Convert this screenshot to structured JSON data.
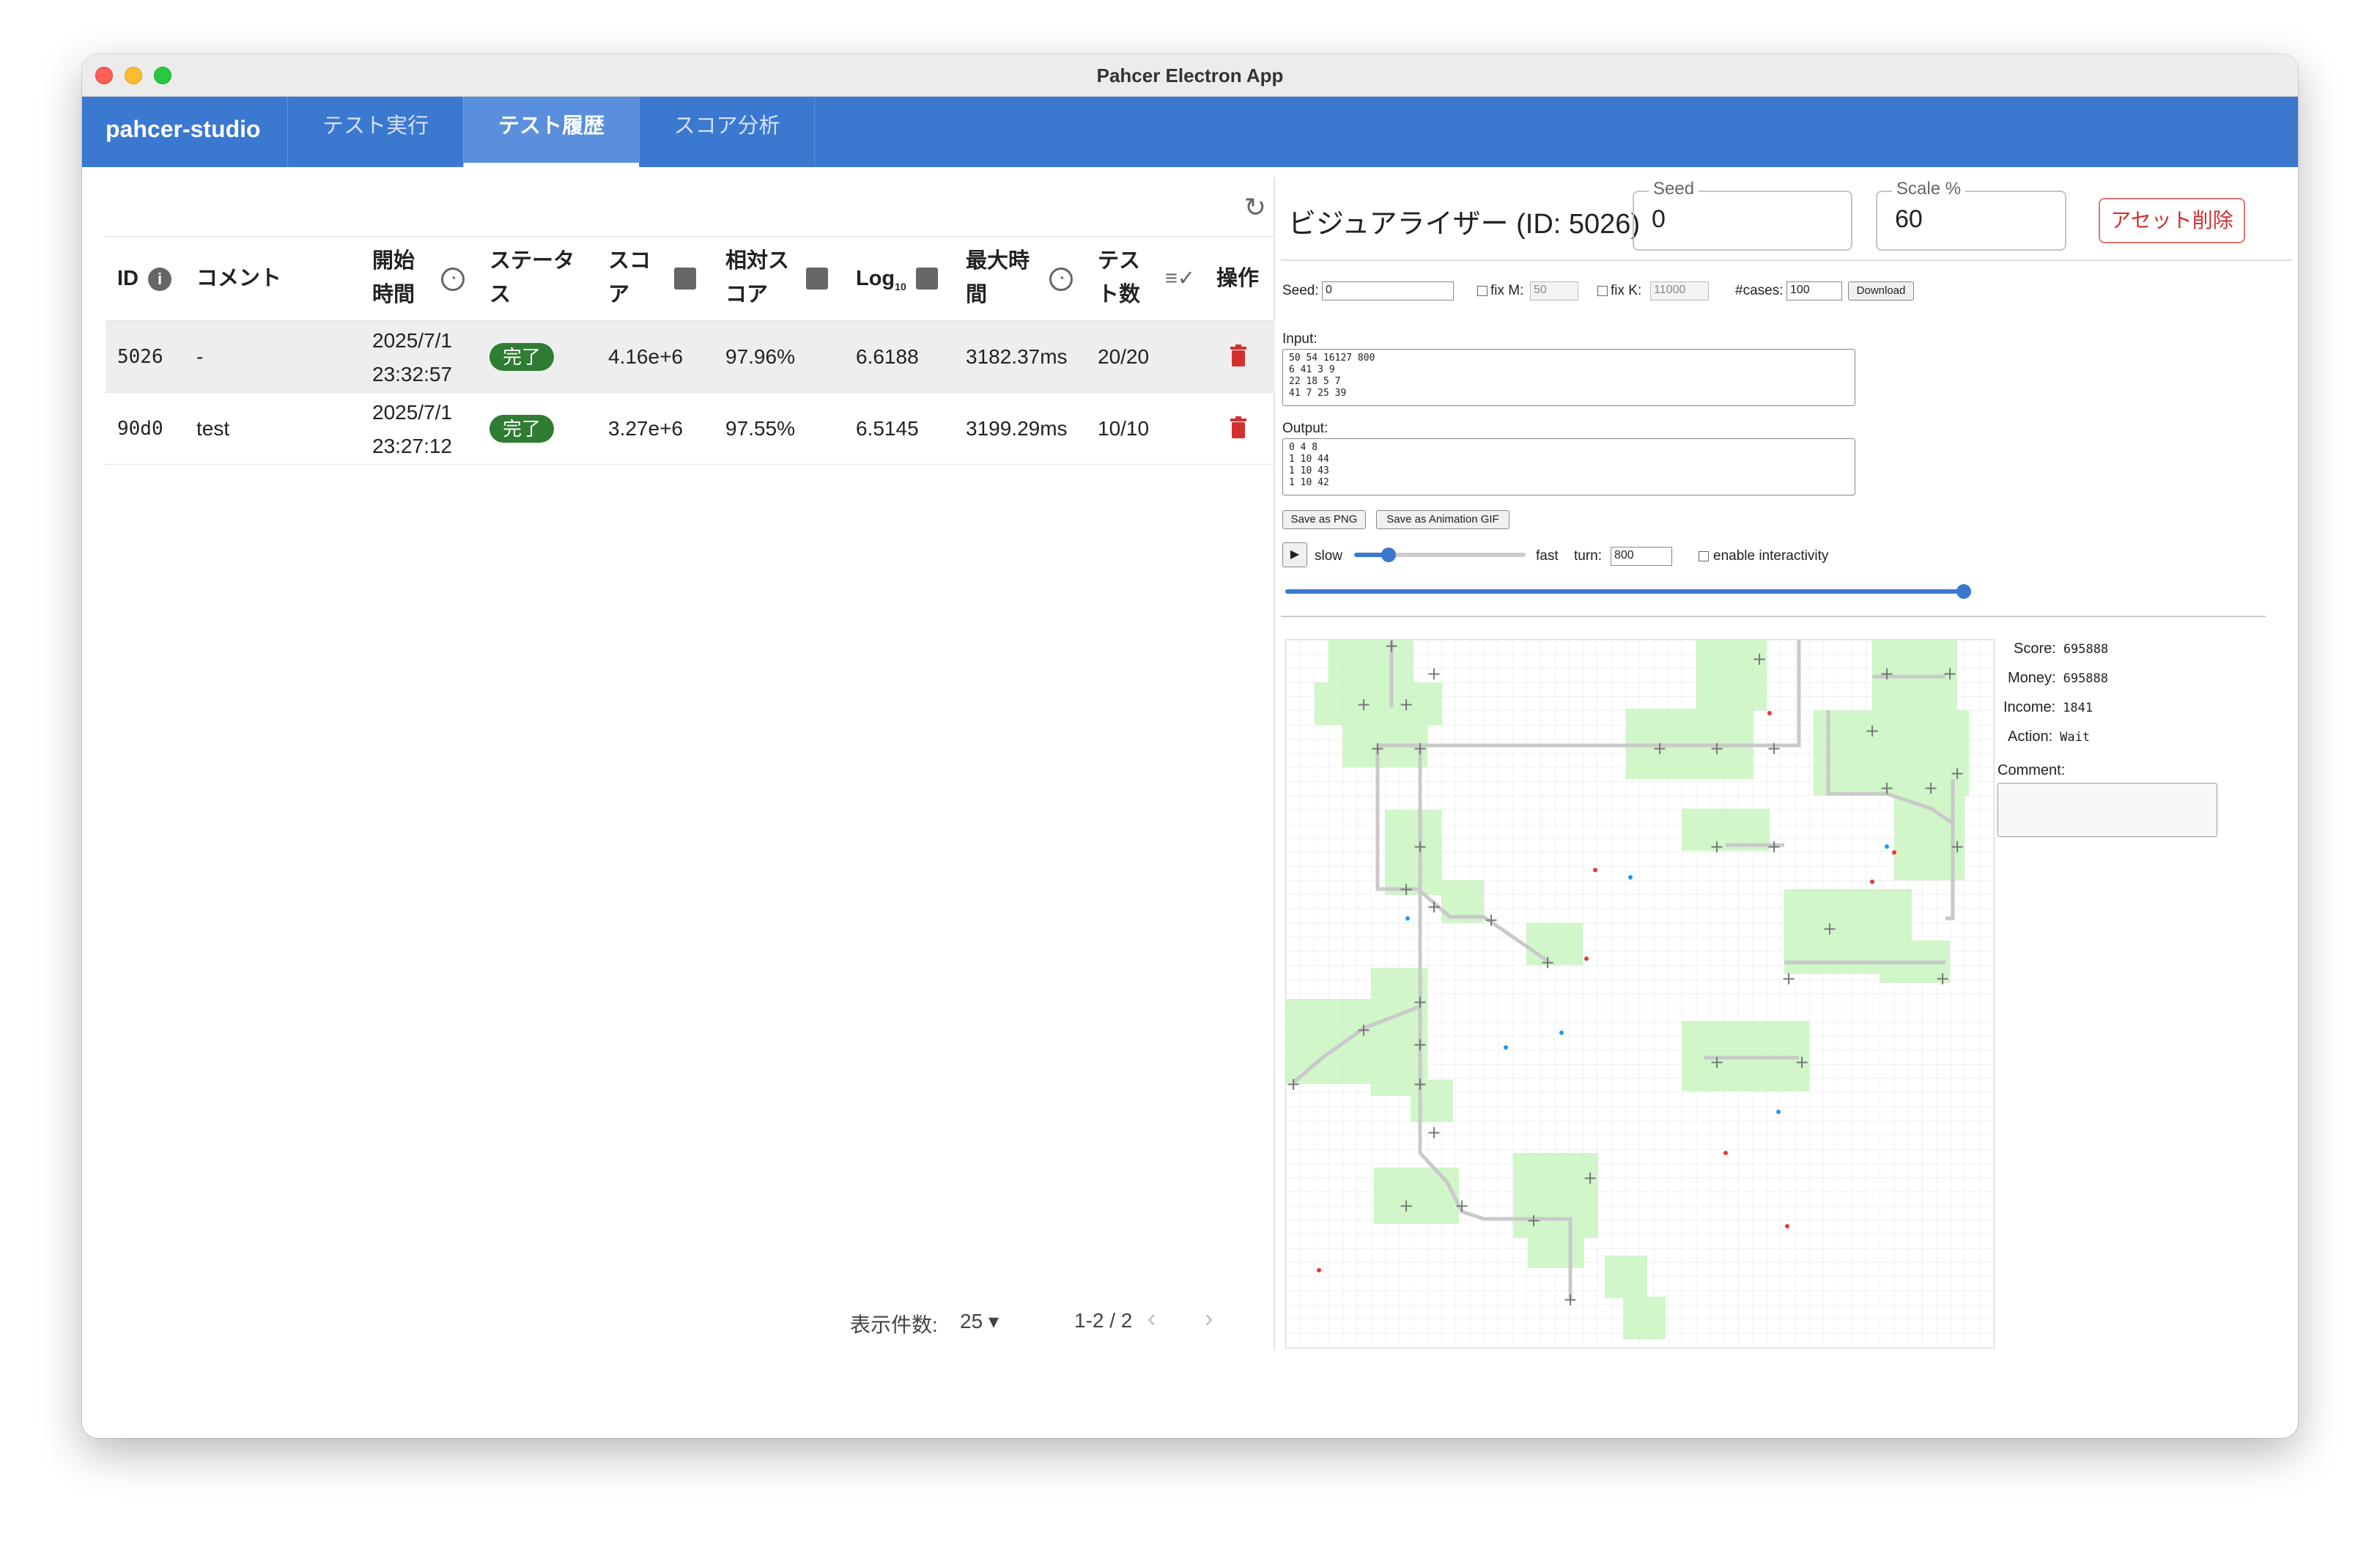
{
  "window": {
    "title": "Pahcer Electron App"
  },
  "app": {
    "brand": "pahcer-studio",
    "tabs": [
      {
        "label": "テスト実行"
      },
      {
        "label": "テスト履歴"
      },
      {
        "label": "スコア分析"
      }
    ],
    "active_tab": "テスト履歴"
  },
  "table": {
    "columns": {
      "id": "ID",
      "comment": "コメント",
      "start_time_1": "開始",
      "start_time_2": "時間",
      "status_1": "ステータ",
      "status_2": "ス",
      "score_1": "スコ",
      "score_2": "ア",
      "relscore_1": "相対ス",
      "relscore_2": "コア",
      "log": "Log",
      "log_sub": "10",
      "maxtime_1": "最大時",
      "maxtime_2": "間",
      "tests_1": "テス",
      "tests_2": "ト数",
      "actions": "操作"
    },
    "rows": [
      {
        "id": "5026",
        "comment": "-",
        "date": "2025/7/1",
        "time": "23:32:57",
        "status": "完了",
        "score": "4.16e+6",
        "relscore": "97.96%",
        "log": "6.6188",
        "maxtime": "3182.37ms",
        "tests": "20/20"
      },
      {
        "id": "90d0",
        "comment": "test",
        "date": "2025/7/1",
        "time": "23:27:12",
        "status": "完了",
        "score": "3.27e+6",
        "relscore": "97.55%",
        "log": "6.5145",
        "maxtime": "3199.29ms",
        "tests": "10/10"
      }
    ]
  },
  "pagination": {
    "rows_label": "表示件数:",
    "rows_value": "25",
    "range": "1-2 / 2"
  },
  "visualizer": {
    "title": "ビジュアライザー (ID: 5026)",
    "seed_label": "Seed",
    "seed_value": "0",
    "scale_label": "Scale %",
    "scale_value": "60",
    "delete_label": "アセット削除",
    "seed_small_label": "Seed:",
    "seed_small_value": "0",
    "fixm_label": "fix M:",
    "fixm_value": "50",
    "fixk_label": "fix K:",
    "fixk_value": "11000",
    "cases_label": "#cases:",
    "cases_value": "100",
    "download_label": "Download",
    "input_label": "Input:",
    "input_text": "50 54 16127 800\n6 41 3 9\n22 18 5 7\n41 7 25 39",
    "output_label": "Output:",
    "output_text": "0 4 8\n1 10 44\n1 10 43\n1 10 42",
    "save_png_label": "Save as PNG",
    "save_gif_label": "Save as Animation GIF",
    "slow_label": "slow",
    "fast_label": "fast",
    "turn_label": "turn:",
    "turn_value": "800",
    "interactivity_label": "enable interactivity",
    "speed_fraction": 0.2,
    "turn_fraction": 1.0,
    "score_label": "Score:",
    "score_value": "695888",
    "money_label": "Money:",
    "money_value": "695888",
    "income_label": "Income:",
    "income_value": "1841",
    "action_label": "Action:",
    "action_value": "Wait",
    "comment_label": "Comment:"
  },
  "colors": {
    "appbar": "#3b78d0",
    "status_done": "#2e7d32",
    "delete": "#d32f2f",
    "station_area": "#c8f5c0"
  }
}
